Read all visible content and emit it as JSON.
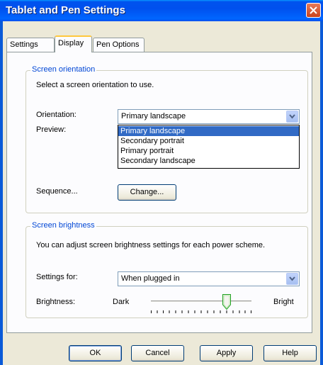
{
  "window": {
    "title": "Tablet and Pen Settings"
  },
  "tabs": [
    {
      "label": "Settings"
    },
    {
      "label": "Display"
    },
    {
      "label": "Pen Options"
    }
  ],
  "screen_orientation": {
    "group_label": "Screen orientation",
    "description": "Select a screen orientation to use.",
    "orientation_label": "Orientation:",
    "orientation_value": "Primary landscape",
    "preview_label": "Preview:",
    "options": [
      "Primary landscape",
      "Secondary portrait",
      "Primary portrait",
      "Secondary landscape"
    ],
    "sequence_label": "Sequence...",
    "change_button": "Change..."
  },
  "screen_brightness": {
    "group_label": "Screen brightness",
    "description": "You can adjust screen brightness settings for each power scheme.",
    "settings_for_label": "Settings for:",
    "settings_for_value": "When plugged in",
    "brightness_label": "Brightness:",
    "dark_label": "Dark",
    "bright_label": "Bright",
    "brightness_level": 0.75
  },
  "buttons": {
    "ok": "OK",
    "cancel": "Cancel",
    "apply": "Apply",
    "help": "Help"
  },
  "colors": {
    "title_bar": "#0053ee",
    "group_label": "#0046d5",
    "selection": "#316ac5",
    "close_button": "#d9542b"
  }
}
